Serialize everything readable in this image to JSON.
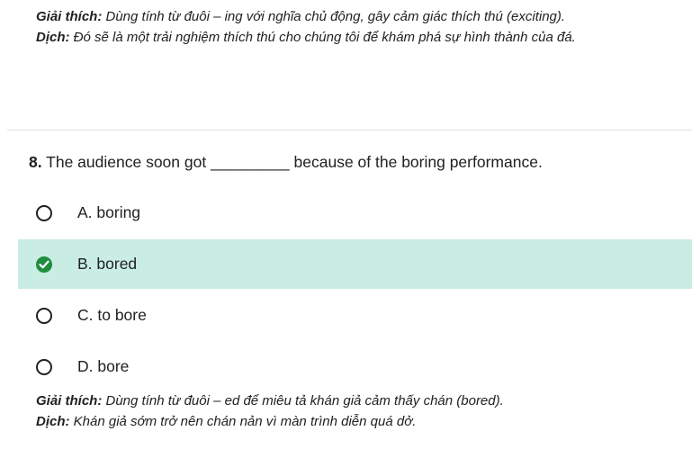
{
  "prev_explanation": {
    "explain_label": "Giải thích:",
    "explain_text": " Dùng tính từ đuôi – ing với nghĩa chủ động, gây cảm giác thích thú (exciting).",
    "translate_label": "Dịch:",
    "translate_text": " Đó sẽ là một trải nghiệm thích thú cho chúng tôi để khám phá sự hình thành của đá."
  },
  "question": {
    "number": "8.",
    "text": " The audience soon got _________ because of the boring performance."
  },
  "options": [
    {
      "label": "A. boring",
      "selected": false
    },
    {
      "label": "B. bored",
      "selected": true
    },
    {
      "label": "C. to bore",
      "selected": false
    },
    {
      "label": "D. bore",
      "selected": false
    }
  ],
  "explanation": {
    "explain_label": "Giải thích:",
    "explain_text": " Dùng tính từ đuôi – ed để miêu tả khán giả cảm thấy chán (bored).",
    "translate_label": "Dịch:",
    "translate_text": " Khán giả sớm trở nên chán nản vì màn trình diễn quá dở."
  },
  "colors": {
    "selected_bg": "#c9ede2",
    "check_green": "#1e8e3e",
    "divider": "#e0e0e0"
  },
  "icons": {
    "radio_unchecked": "radio-unchecked-icon",
    "radio_checked": "check-circle-icon"
  }
}
